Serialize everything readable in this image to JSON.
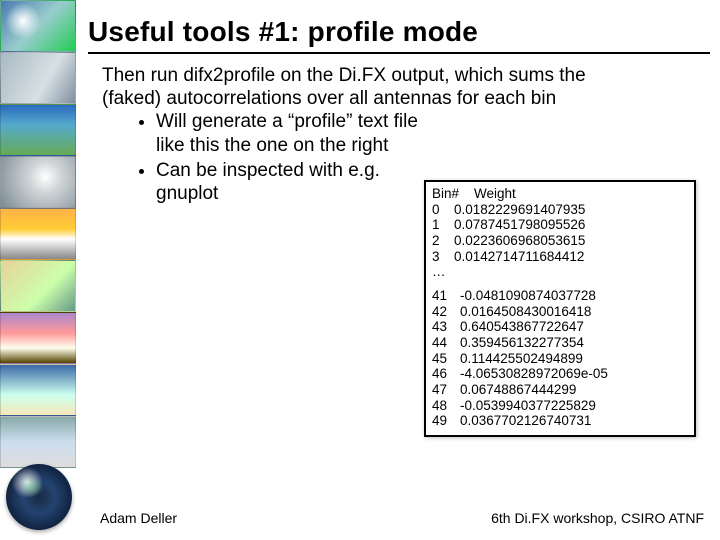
{
  "title": "Useful tools #1: profile mode",
  "paragraph": "Then run difx2profile on the Di.FX output, which sums the (faked) autocorrelations over all antennas for each bin",
  "bullets": [
    "Will generate a “profile” text file like this the one on the right",
    "Can be inspected with e.g. gnuplot"
  ],
  "profile": {
    "header": {
      "col1": "Bin#",
      "col2": "Weight"
    },
    "top_rows": [
      {
        "bin": "0",
        "weight": "0.0182229691407935"
      },
      {
        "bin": "1",
        "weight": "0.0787451798095526"
      },
      {
        "bin": "2",
        "weight": "0.0223606968053615"
      },
      {
        "bin": "3",
        "weight": "0.0142714711684412"
      }
    ],
    "ellipsis": "…",
    "bottom_rows": [
      {
        "bin": "41",
        "weight": "-0.0481090874037728"
      },
      {
        "bin": "42",
        "weight": "0.0164508430016418"
      },
      {
        "bin": "43",
        "weight": "0.640543867722647"
      },
      {
        "bin": "44",
        "weight": "0.359456132277354"
      },
      {
        "bin": "45",
        "weight": "0.114425502494899"
      },
      {
        "bin": "46",
        "weight": "-4.06530828972069e-05"
      },
      {
        "bin": "47",
        "weight": "0.06748867444299"
      },
      {
        "bin": "48",
        "weight": "-0.0539940377225829"
      },
      {
        "bin": "49",
        "weight": "0.0367702126740731"
      }
    ]
  },
  "footer": {
    "left": "Adam Deller",
    "right": "6th Di.FX workshop, CSIRO ATNF"
  }
}
